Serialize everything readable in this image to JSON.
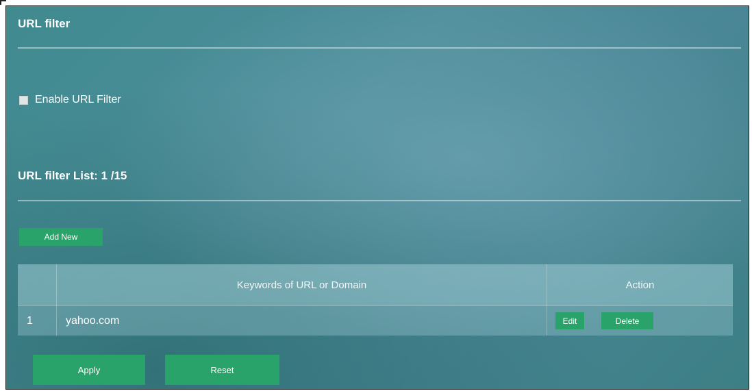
{
  "page": {
    "title": "URL filter",
    "enable_label": "Enable URL Filter",
    "enable_checked": false,
    "list_title": "URL filter List: 1 /15"
  },
  "buttons": {
    "add_new": "Add New",
    "apply": "Apply",
    "reset": "Reset"
  },
  "table": {
    "columns": [
      "",
      "Keywords of URL or Domain",
      "Action"
    ],
    "rows": [
      {
        "index": "1",
        "keyword": "yahoo.com",
        "edit_label": "Edit",
        "delete_label": "Delete"
      }
    ]
  },
  "colors": {
    "button_green": "#2aa36a",
    "background_teal": "#4a8796"
  }
}
